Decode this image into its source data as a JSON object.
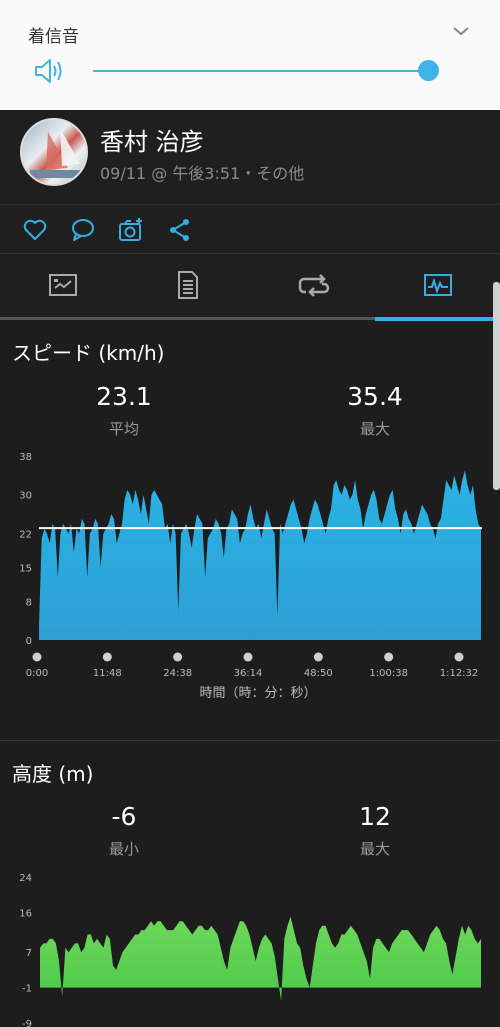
{
  "volume": {
    "title": "着信音",
    "level_percent": 100
  },
  "post": {
    "user_name": "香村 治彦",
    "meta": "09/11 @ 午後3:51・その他"
  },
  "actions": [
    "like-icon",
    "comment-icon",
    "add-photo-icon",
    "share-icon"
  ],
  "tabs": [
    {
      "icon": "summary-icon",
      "active": false
    },
    {
      "icon": "stats-icon",
      "active": false
    },
    {
      "icon": "laps-icon",
      "active": false
    },
    {
      "icon": "charts-icon",
      "active": true
    }
  ],
  "colors": {
    "accent": "#33aee4",
    "speed_fill": "#2e9fd4",
    "altitude_fill": "#4cc94a"
  },
  "speed": {
    "title": "スピード (km/h)",
    "avg_value": "23.1",
    "avg_label": "平均",
    "max_value": "35.4",
    "max_label": "最大"
  },
  "altitude": {
    "title": "高度 (m)",
    "min_value": "-6",
    "min_label": "最小",
    "max_value": "12",
    "max_label": "最大"
  },
  "chart_data": [
    {
      "type": "area",
      "ylim": [
        0,
        38
      ],
      "yticks": [
        "38",
        "30",
        "22",
        "15",
        "8",
        "0"
      ],
      "xticks": [
        "0:00",
        "11:48",
        "24:38",
        "36:14",
        "48:50",
        "1:00:38",
        "1:12:32"
      ],
      "xlabel": "時間（時：分：秒）",
      "reference_line": 23.1,
      "series": [
        {
          "values": [
            3,
            21,
            23,
            22,
            20,
            24,
            23,
            13,
            22,
            24,
            23,
            22,
            24,
            18,
            23,
            22,
            25,
            24,
            13,
            22,
            23,
            25,
            24,
            15,
            22,
            23,
            24,
            26,
            25,
            20,
            22,
            24,
            29,
            31,
            30,
            28,
            31,
            29,
            26,
            30,
            27,
            24,
            30,
            31,
            30,
            29,
            28,
            23,
            24,
            20,
            24,
            22,
            6,
            22,
            23,
            24,
            22,
            19,
            23,
            26,
            25,
            24,
            13,
            21,
            22,
            23,
            25,
            24,
            22,
            17,
            23,
            24,
            27,
            26,
            25,
            20,
            22,
            23,
            26,
            28,
            25,
            23,
            24,
            21,
            24,
            27,
            25,
            23,
            22,
            5,
            24,
            22,
            24,
            26,
            28,
            29,
            27,
            25,
            23,
            20,
            22,
            25,
            27,
            29,
            28,
            26,
            24,
            22,
            25,
            27,
            32,
            33,
            31,
            30,
            32,
            31,
            29,
            30,
            33,
            29,
            27,
            23,
            26,
            28,
            30,
            31,
            29,
            25,
            24,
            26,
            28,
            30,
            31,
            27,
            25,
            22,
            26,
            27,
            25,
            24,
            22,
            24,
            26,
            28,
            27,
            26,
            24,
            23,
            21,
            24,
            25,
            29,
            33,
            32,
            31,
            34,
            32,
            30,
            33,
            35,
            32,
            30,
            32,
            27,
            24,
            23
          ]
        }
      ]
    },
    {
      "type": "area",
      "ylim": [
        -9,
        24
      ],
      "yticks": [
        "24",
        "16",
        "7",
        "-1",
        "-9"
      ],
      "series": [
        {
          "values": [
            8,
            9,
            9,
            10,
            10,
            9,
            5,
            -3,
            8,
            7,
            8,
            9,
            9,
            7,
            8,
            11,
            11,
            9,
            10,
            9,
            8,
            11,
            10,
            4,
            3,
            5,
            7,
            8,
            9,
            10,
            11,
            11,
            12,
            12,
            13,
            14,
            13,
            14,
            14,
            13,
            12,
            12,
            12,
            13,
            14,
            14,
            13,
            12,
            11,
            12,
            13,
            13,
            12,
            12,
            13,
            12,
            11,
            8,
            5,
            3,
            8,
            10,
            12,
            14,
            14,
            13,
            11,
            8,
            5,
            8,
            10,
            11,
            10,
            9,
            6,
            1,
            -4,
            10,
            13,
            15,
            12,
            9,
            8,
            4,
            1,
            -1,
            4,
            9,
            12,
            13,
            13,
            11,
            9,
            8,
            9,
            11,
            11,
            12,
            13,
            12,
            11,
            9,
            7,
            5,
            1,
            8,
            10,
            10,
            9,
            8,
            7,
            9,
            10,
            11,
            12,
            12,
            12,
            11,
            10,
            9,
            8,
            7,
            9,
            11,
            12,
            13,
            12,
            10,
            9,
            5,
            2,
            6,
            10,
            13,
            11,
            13,
            12,
            10,
            9,
            10
          ]
        }
      ]
    }
  ]
}
